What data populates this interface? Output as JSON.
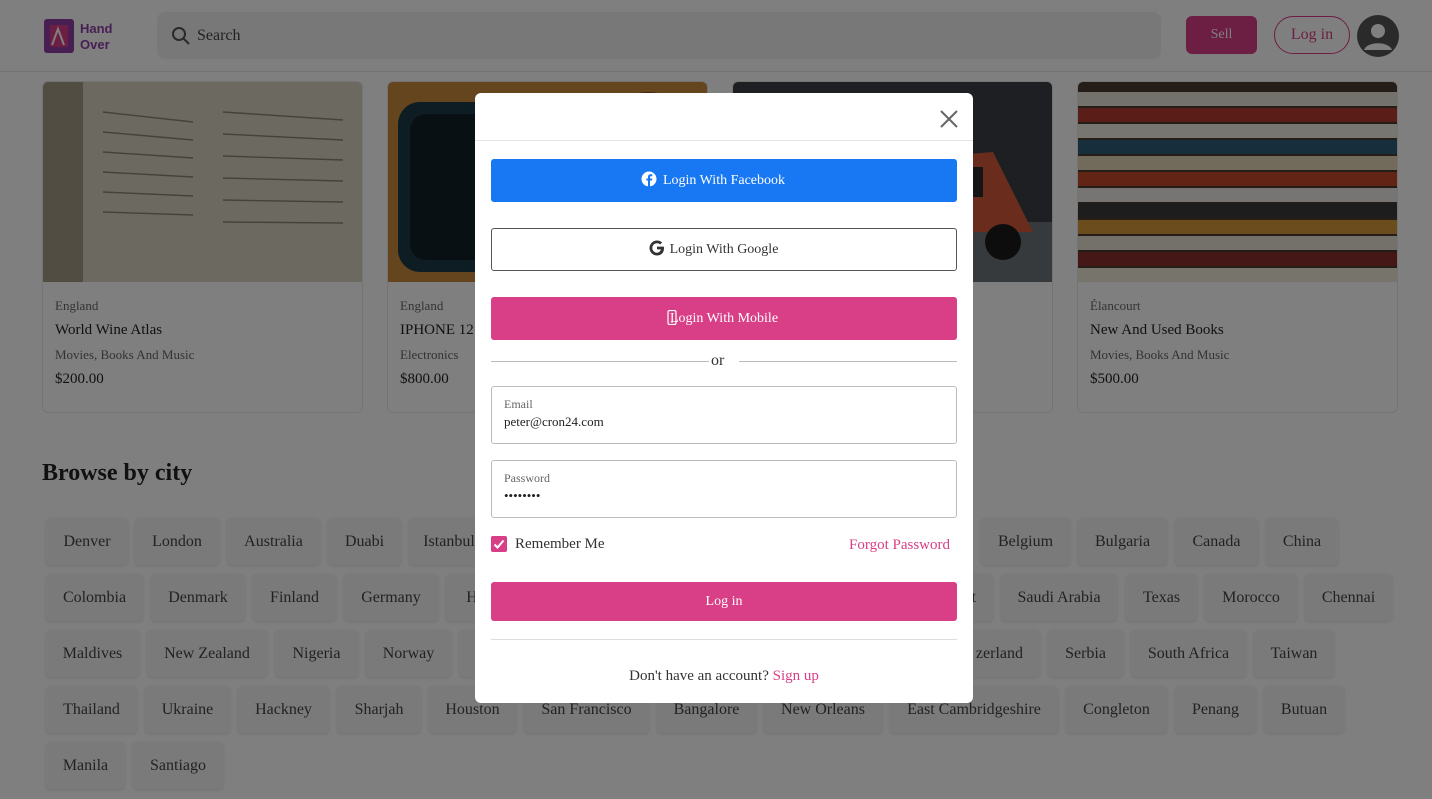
{
  "header": {
    "search_placeholder": "Search",
    "sell_label": "Sell",
    "login_label": "Log in"
  },
  "listings": [
    {
      "location": "England",
      "title": "World Wine Atlas",
      "category": "Movies, Books And Music",
      "price": "$200.00"
    },
    {
      "location": "England",
      "title": "IPHONE 12",
      "category": "Electronics",
      "price": "$800.00"
    },
    {
      "location": "",
      "title": "",
      "category": "",
      "price": ""
    },
    {
      "location": "Élancourt",
      "title": "New And Used Books",
      "category": "Movies, Books And Music",
      "price": "$500.00"
    }
  ],
  "browse": {
    "title": "Browse by city",
    "cities": [
      "Denver",
      "London",
      "Australia",
      "Duabi",
      "Istanbul",
      "Belgium",
      "Bulgaria",
      "Canada",
      "China",
      "Colombia",
      "Denmark",
      "Finland",
      "Germany",
      "Ho",
      "t",
      "Saudi Arabia",
      "Texas",
      "Morocco",
      "Chennai",
      "Maldives",
      "New Zealand",
      "Nigeria",
      "Norway",
      "zerland",
      "Serbia",
      "South Africa",
      "Taiwan",
      "Thailand",
      "Ukraine",
      "Hackney",
      "Sharjah",
      "Houston",
      "San Francisco",
      "Bangalore",
      "New Orleans",
      "East Cambridgeshire",
      "Congleton",
      "Penang",
      "Butuan",
      "Manila",
      "Santiago"
    ]
  },
  "modal": {
    "facebook_label": "Login With Facebook",
    "google_label": "Login With Google",
    "mobile_label": "Login With Mobile",
    "or_text": "or",
    "email_label": "Email",
    "email_value": "peter@cron24.com",
    "password_label": "Password",
    "password_value": "••••••••",
    "remember_label": "Remember Me",
    "forgot_label": "Forgot Password",
    "login_label": "Log in",
    "no_account_text": "Don't have an account?",
    "signup_label": "Sign up"
  },
  "colors": {
    "brand": "#d83f87",
    "facebook": "#1877f2"
  }
}
